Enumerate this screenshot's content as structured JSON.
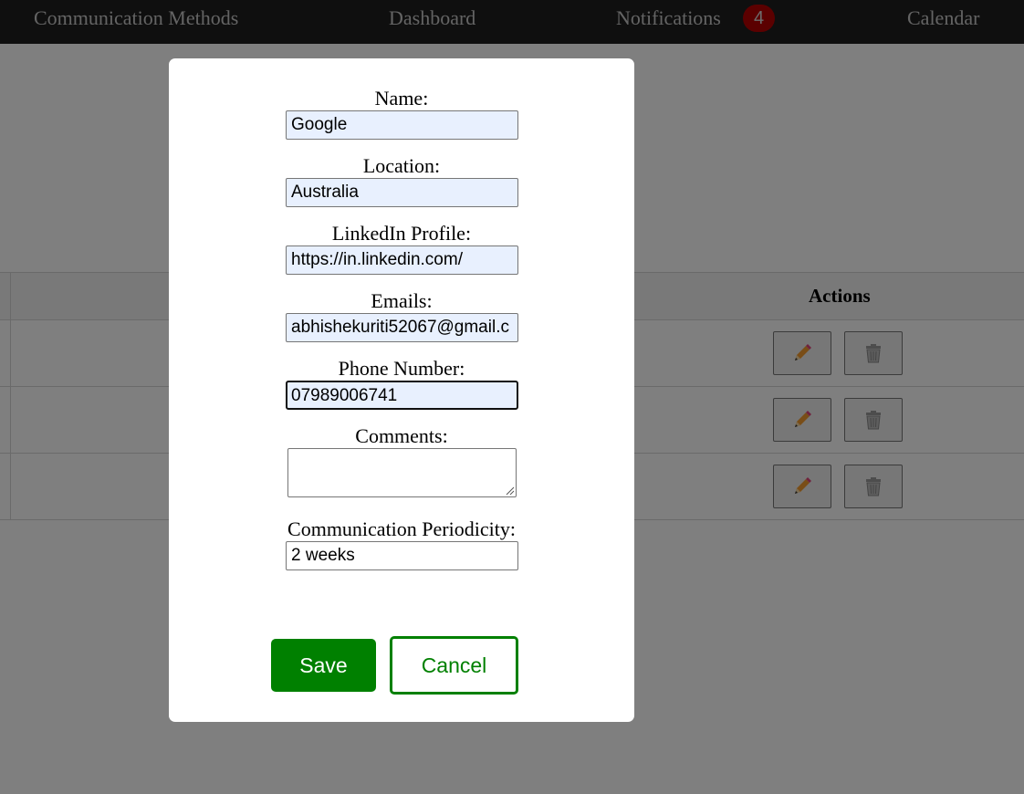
{
  "nav": {
    "items": [
      {
        "label": "Communication Methods"
      },
      {
        "label": "Dashboard"
      },
      {
        "label": "Notifications"
      },
      {
        "label": "Calendar"
      }
    ],
    "notification_count": "4"
  },
  "table": {
    "actions_header": "Actions",
    "rows": [
      {
        "edit_icon": "pencil-icon",
        "delete_icon": "trash-icon"
      },
      {
        "edit_icon": "pencil-icon",
        "delete_icon": "trash-icon"
      },
      {
        "edit_icon": "pencil-icon",
        "delete_icon": "trash-icon"
      }
    ]
  },
  "form": {
    "name": {
      "label": "Name:",
      "value": "Google"
    },
    "location": {
      "label": "Location:",
      "value": "Australia"
    },
    "linkedin": {
      "label": "LinkedIn Profile:",
      "value": "https://in.linkedin.com/"
    },
    "emails": {
      "label": "Emails:",
      "value": "abhishekuriti52067@gmail.c"
    },
    "phone": {
      "label": "Phone Number:",
      "value": "07989006741"
    },
    "comments": {
      "label": "Comments:",
      "value": ""
    },
    "periodicity": {
      "label": "Communication Periodicity:",
      "value": "2 weeks"
    },
    "save_label": "Save",
    "cancel_label": "Cancel"
  },
  "colors": {
    "accent_green": "#008000",
    "badge_red": "#b60000",
    "navbar_bg": "#1e1e1e",
    "autofill_bg": "#e8f0fe"
  }
}
